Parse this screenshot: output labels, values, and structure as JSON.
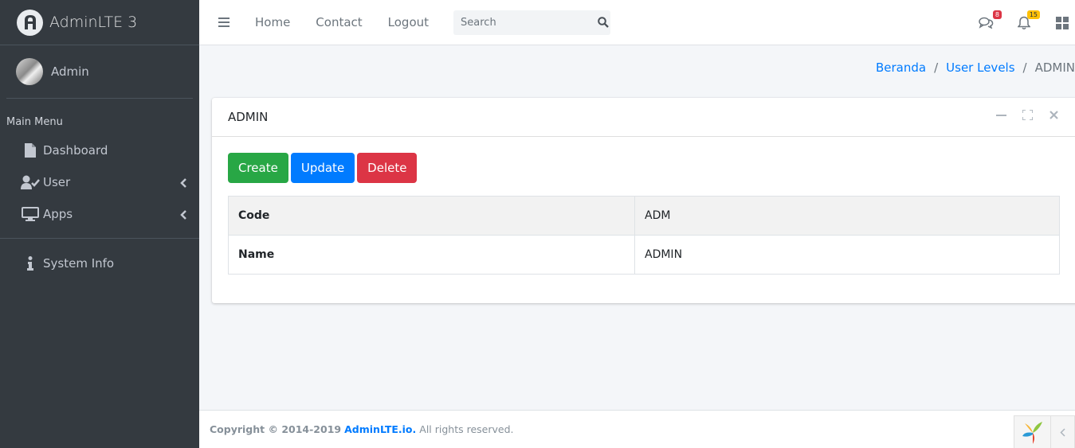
{
  "brand": {
    "name": "AdminLTE 3",
    "logo_icon": "adminlte-logo-icon"
  },
  "user": {
    "name": "Admin"
  },
  "sidebar": {
    "header": "Main Menu",
    "items": [
      {
        "label": "Dashboard",
        "icon": "file-icon",
        "has_submenu": false
      },
      {
        "label": "User",
        "icon": "user-check-icon",
        "has_submenu": true
      },
      {
        "label": "Apps",
        "icon": "desktop-icon",
        "has_submenu": true
      }
    ],
    "system_item": {
      "label": "System Info",
      "icon": "info-icon"
    }
  },
  "navbar": {
    "links": [
      "Home",
      "Contact",
      "Logout"
    ],
    "search": {
      "placeholder": "Search",
      "value": ""
    },
    "messages_badge": "8",
    "notifications_badge": "15"
  },
  "breadcrumb": {
    "items": [
      "Beranda",
      "User Levels"
    ],
    "active": "ADMIN"
  },
  "card": {
    "title": "ADMIN",
    "buttons": {
      "create": "Create",
      "update": "Update",
      "delete": "Delete"
    },
    "rows": [
      {
        "key": "Code",
        "value": "ADM"
      },
      {
        "key": "Name",
        "value": "ADMIN"
      }
    ]
  },
  "footer": {
    "copyright": "Copyright © 2014-2019",
    "brand": "AdminLTE.io.",
    "rest": "All rights reserved."
  },
  "colors": {
    "sidebar_bg": "#343a40",
    "primary": "#007bff",
    "success": "#28a745",
    "danger": "#dc3545",
    "warning": "#ffc107"
  }
}
